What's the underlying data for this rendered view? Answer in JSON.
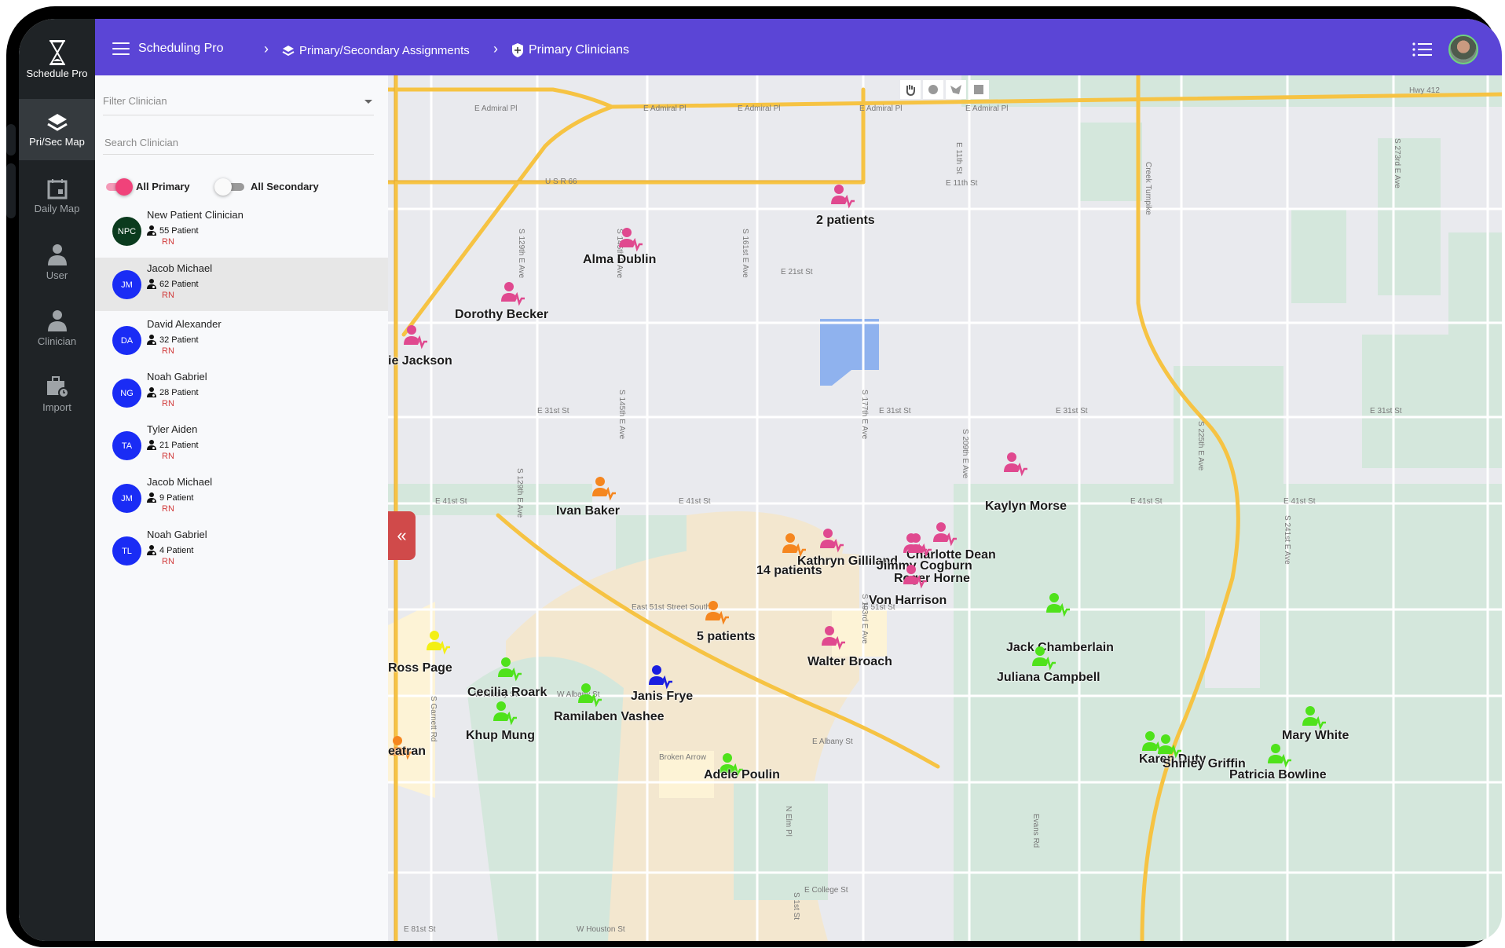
{
  "brand": {
    "name": "Schedule Pro"
  },
  "rail": {
    "items": [
      {
        "label": "Pri/Sec Map",
        "icon": "layers-icon",
        "active": true
      },
      {
        "label": "Daily Map",
        "icon": "calendar-icon",
        "active": false
      },
      {
        "label": "User",
        "icon": "user-icon",
        "active": false
      },
      {
        "label": "Clinician",
        "icon": "clinician-icon",
        "active": false
      },
      {
        "label": "Import",
        "icon": "import-briefcase-icon",
        "active": false
      }
    ]
  },
  "header": {
    "app_title": "Scheduling Pro",
    "breadcrumbs": [
      {
        "label": "Primary/Secondary Assignments",
        "icon": "layers-icon"
      },
      {
        "label": "Primary Clinicians",
        "icon": "shield-plus-icon"
      }
    ],
    "menu_icon": "list-icon",
    "avatar": "user-avatar"
  },
  "panel": {
    "filter": {
      "placeholder": "Filter Clinician",
      "value": ""
    },
    "search": {
      "placeholder": "Search Clinician",
      "value": ""
    },
    "toggles": [
      {
        "label": "All Primary",
        "on": true
      },
      {
        "label": "All Secondary",
        "on": false
      }
    ],
    "clinicians": [
      {
        "initials": "NPC",
        "name": "New Patient Clinician",
        "patients": "55 Patient",
        "role": "RN",
        "color": "#0b3b1e",
        "selected": false
      },
      {
        "initials": "JM",
        "name": "Jacob Michael",
        "patients": "62 Patient",
        "role": "RN",
        "color": "#1a2cf5",
        "selected": true
      },
      {
        "initials": "DA",
        "name": "David Alexander",
        "patients": "32 Patient",
        "role": "RN",
        "color": "#1a2cf5",
        "selected": false
      },
      {
        "initials": "NG",
        "name": "Noah Gabriel",
        "patients": "28 Patient",
        "role": "RN",
        "color": "#1a2cf5",
        "selected": false
      },
      {
        "initials": "TA",
        "name": "Tyler Aiden",
        "patients": "21 Patient",
        "role": "RN",
        "color": "#1a2cf5",
        "selected": false
      },
      {
        "initials": "JM",
        "name": "Jacob Michael",
        "patients": "9 Patient",
        "role": "RN",
        "color": "#1a2cf5",
        "selected": false
      },
      {
        "initials": "TL",
        "name": "Noah Gabriel",
        "patients": "4 Patient",
        "role": "RN",
        "color": "#1a2cf5",
        "selected": false
      }
    ]
  },
  "map": {
    "collapse_label": "«",
    "draw_tools": [
      "pan-hand-icon",
      "circle-draw-icon",
      "polygon-draw-icon",
      "rectangle-draw-icon"
    ],
    "colors": {
      "pink": "#e0498f",
      "orange": "#f5861f",
      "green": "#4fe21b",
      "yellow": "#f3ef14",
      "blue": "#1a1ee0"
    },
    "markers": [
      {
        "label": "2 patients",
        "color": "pink"
      },
      {
        "label": "Alma Dublin",
        "color": "pink"
      },
      {
        "label": "Dorothy Becker",
        "color": "pink"
      },
      {
        "label": "ie Jackson",
        "color": "pink"
      },
      {
        "label": "Ivan Baker",
        "color": "orange"
      },
      {
        "label": "Kaylyn Morse",
        "color": "pink"
      },
      {
        "label": "Kathryn Gilliland",
        "color": "pink"
      },
      {
        "label": "14 patients",
        "color": "orange"
      },
      {
        "label": "Charlotte Dean",
        "color": "pink"
      },
      {
        "label": "Jimmy Cogburn",
        "color": "pink"
      },
      {
        "label": "Roger Horne",
        "color": "pink"
      },
      {
        "label": "Von Harrison",
        "color": "pink"
      },
      {
        "label": "5 patients",
        "color": "orange"
      },
      {
        "label": "Walter Broach",
        "color": "pink"
      },
      {
        "label": "Jack Chamberlain",
        "color": "green"
      },
      {
        "label": "Juliana Campbell",
        "color": "green"
      },
      {
        "label": "Ross Page",
        "color": "yellow"
      },
      {
        "label": "Cecilia Roark",
        "color": "green"
      },
      {
        "label": "Janis Frye",
        "color": "blue"
      },
      {
        "label": "Ramilaben Vashee",
        "color": "green"
      },
      {
        "label": "Khup Mung",
        "color": "green"
      },
      {
        "label": "eatran",
        "color": "orange"
      },
      {
        "label": "Adele Poulin",
        "color": "green"
      },
      {
        "label": "Karen Duty",
        "color": "green"
      },
      {
        "label": "Shirley Griffin",
        "color": "green"
      },
      {
        "label": "Patricia Bowline",
        "color": "green"
      },
      {
        "label": "Mary White",
        "color": "green"
      }
    ],
    "streets": [
      "E Admiral Pl",
      "E Admiral Pl",
      "E Admiral Pl",
      "E Admiral Pl",
      "E Admiral Pl",
      "U S R 66",
      "E 11th St",
      "E 21st St",
      "E 31st St",
      "E 31st St",
      "E 31st St",
      "E 31st St",
      "E 41st St",
      "E 41st St",
      "E 41st St",
      "E 41st St",
      "East 51st Street South",
      "E 51st St",
      "W Albany St",
      "W Albany St",
      "E Albany St",
      "Broken Arrow",
      "E College St",
      "W Houston St",
      "E 81st St",
      "Hwy 412",
      "Creek Turnpike",
      "S 129th E Ave",
      "S 145th E Ave",
      "S 161st E Ave",
      "S 177th E Ave",
      "S 209th E Ave",
      "S 145th E Ave",
      "S 129th E Ave",
      "S Garnett Rd",
      "S 193rd E Ave",
      "S 225th E Ave",
      "S 241st E Ave",
      "S 273rd E Ave",
      "Evans Rd",
      "N Elm Pl",
      "S 1st St",
      "E 11th St"
    ]
  }
}
